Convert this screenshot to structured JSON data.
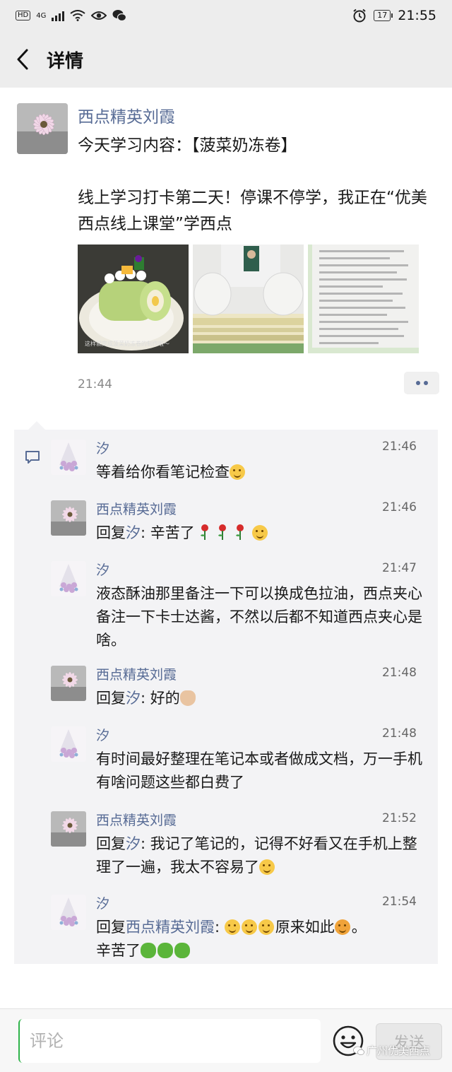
{
  "status_bar": {
    "hd": "HD",
    "network": "4G",
    "battery": "17",
    "time": "21:55"
  },
  "nav": {
    "title": "详情"
  },
  "post": {
    "author": "西点精英刘霞",
    "text_line1": "今天学习内容：【菠菜奶冻卷",
    "text_line2": "】",
    "text_para2": "线上学习打卡第二天！停课不停学，我正在“优美西点线上课堂”学西点",
    "image_caption": "这样就完成菠菜奶冻卷的制作啦～",
    "time": "21:44"
  },
  "comments": [
    {
      "name": "汐",
      "time": "21:46",
      "text": "等着给你看笔记检查"
    },
    {
      "name": "西点精英刘霞",
      "time": "21:46",
      "reply_prefix": "回复",
      "reply_to": "汐",
      "text": ": 辛苦了"
    },
    {
      "name": "汐",
      "time": "21:47",
      "text": "液态酥油那里备注一下可以换成色拉油，西点夹心备注一下卡士达酱，不然以后都不知道西点夹心是啥。"
    },
    {
      "name": "西点精英刘霞",
      "time": "21:48",
      "reply_prefix": "回复",
      "reply_to": "汐",
      "text": ": 好的"
    },
    {
      "name": "汐",
      "time": "21:48",
      "text": "有时间最好整理在笔记本或者做成文档，万一手机有啥问题这些都白费了"
    },
    {
      "name": "西点精英刘霞",
      "time": "21:52",
      "reply_prefix": "回复",
      "reply_to": "汐",
      "text": ": 我记了笔记的，记得不好看又在手机上整理了一遍，我太不容易了"
    },
    {
      "name": "汐",
      "time": "21:54",
      "reply_prefix": "回复",
      "reply_to": "西点精英刘霞",
      "text_a": ": ",
      "text_b": "原来如此",
      "text_c": "。",
      "text_d": "辛苦了"
    }
  ],
  "input_bar": {
    "placeholder": "评论",
    "send_label": "发送"
  },
  "watermark": "广州优美西点"
}
